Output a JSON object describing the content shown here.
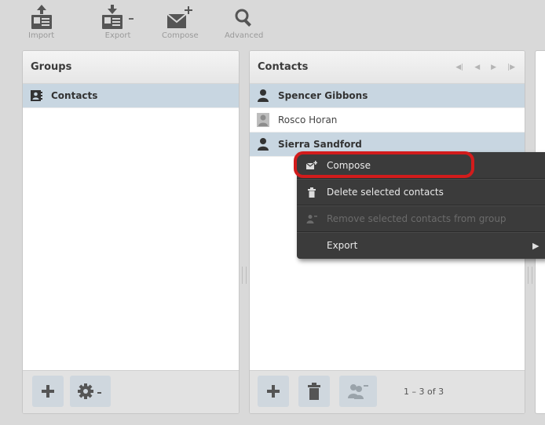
{
  "toolbar": {
    "import_label": "Import",
    "export_label": "Export",
    "compose_label": "Compose",
    "advanced_label": "Advanced"
  },
  "groups": {
    "title": "Groups",
    "items": [
      {
        "label": "Contacts"
      }
    ]
  },
  "contacts": {
    "title": "Contacts",
    "rows": [
      {
        "name": "Spencer Gibbons"
      },
      {
        "name": "Rosco Horan"
      },
      {
        "name": "Sierra Sandford"
      }
    ],
    "pagination": "1 – 3 of 3"
  },
  "context_menu": {
    "items": [
      {
        "label": "Compose",
        "icon": "compose-icon",
        "enabled": true
      },
      {
        "label": "Delete selected contacts",
        "icon": "trash-icon",
        "enabled": true
      },
      {
        "label": "Remove selected contacts from group",
        "icon": "remove-contact-icon",
        "enabled": false
      },
      {
        "label": "Export",
        "icon": "",
        "enabled": true
      }
    ]
  },
  "colors": {
    "selected_row": "#c8d6e1",
    "menu_bg": "#3b3b3b",
    "highlight": "#d21c1c"
  }
}
